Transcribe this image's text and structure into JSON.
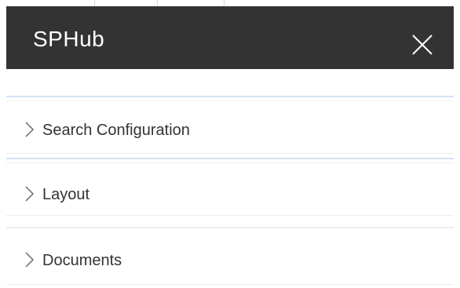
{
  "panel": {
    "title": "SPHub",
    "close_icon": "close-icon"
  },
  "sections": [
    {
      "label": "Search Configuration",
      "icon": "chevron-right-icon",
      "expanded": false
    },
    {
      "label": "Layout",
      "icon": "chevron-right-icon",
      "expanded": false
    },
    {
      "label": "Documents",
      "icon": "chevron-right-icon",
      "expanded": false
    }
  ],
  "colors": {
    "header_bg": "#333333",
    "header_text": "#ffffff",
    "accent_line": "#d2e4f6",
    "divider": "#ededed",
    "label_text": "#333333"
  }
}
